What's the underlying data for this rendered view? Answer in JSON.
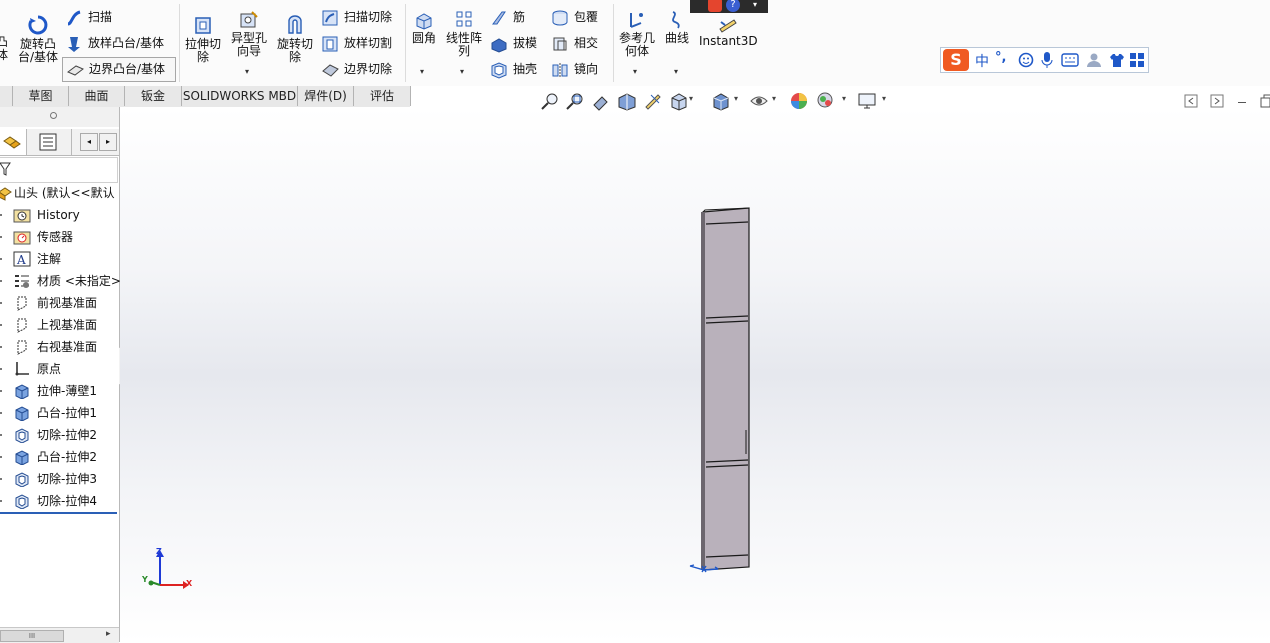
{
  "ribbon": {
    "partial_left_label": "凸\n体",
    "revolve_boss": "旋转凸\n台/基体",
    "sweep": "扫描",
    "loft_boss": "放样凸台/基体",
    "boundary_boss": "边界凸台/基体",
    "extrude_cut": "拉伸切\n除",
    "hole_wizard": "异型孔\n向导",
    "revolve_cut": "旋转切\n除",
    "sweep_cut": "扫描切除",
    "loft_cut": "放样切割",
    "boundary_cut": "边界切除",
    "fillet": "圆角",
    "linear_pattern": "线性阵\n列",
    "rib": "筋",
    "draft": "拔模",
    "shell": "抽壳",
    "wrap": "包覆",
    "intersect": "相交",
    "mirror": "镜向",
    "reference_geometry": "参考几\n何体",
    "curves": "曲线",
    "instant3d": "Instant3D"
  },
  "tabs": [
    {
      "label": "草图"
    },
    {
      "label": "曲面"
    },
    {
      "label": "钣金"
    },
    {
      "label": "SOLIDWORKS MBD"
    },
    {
      "label": "焊件(D)"
    },
    {
      "label": "评估"
    }
  ],
  "tree": {
    "root": "山头 (默认<<默认",
    "items": [
      {
        "label": "History",
        "icon": "history-folder-icon"
      },
      {
        "label": "传感器",
        "icon": "sensor-icon"
      },
      {
        "label": "注解",
        "icon": "annotation-icon"
      },
      {
        "label": "材质 <未指定>",
        "icon": "material-icon"
      },
      {
        "label": "前视基准面",
        "icon": "plane-icon"
      },
      {
        "label": "上视基准面",
        "icon": "plane-icon"
      },
      {
        "label": "右视基准面",
        "icon": "plane-icon"
      },
      {
        "label": "原点",
        "icon": "origin-icon"
      },
      {
        "label": "拉伸-薄壁1",
        "icon": "boss-feature-icon"
      },
      {
        "label": "凸台-拉伸1",
        "icon": "boss-feature-icon"
      },
      {
        "label": "切除-拉伸2",
        "icon": "cut-feature-icon"
      },
      {
        "label": "凸台-拉伸2",
        "icon": "boss-feature-icon"
      },
      {
        "label": "切除-拉伸3",
        "icon": "cut-feature-icon"
      },
      {
        "label": "切除-拉伸4",
        "icon": "cut-feature-icon"
      }
    ]
  },
  "sogou": {
    "logo": "S",
    "mode": "中",
    "punct": "°,"
  },
  "triad": {
    "x": "X",
    "y": "Y",
    "z": "Z"
  },
  "colors": {
    "accent": "#1f58c8",
    "model_face": "#b9b1bb",
    "sogou_orange": "#f05a22"
  }
}
